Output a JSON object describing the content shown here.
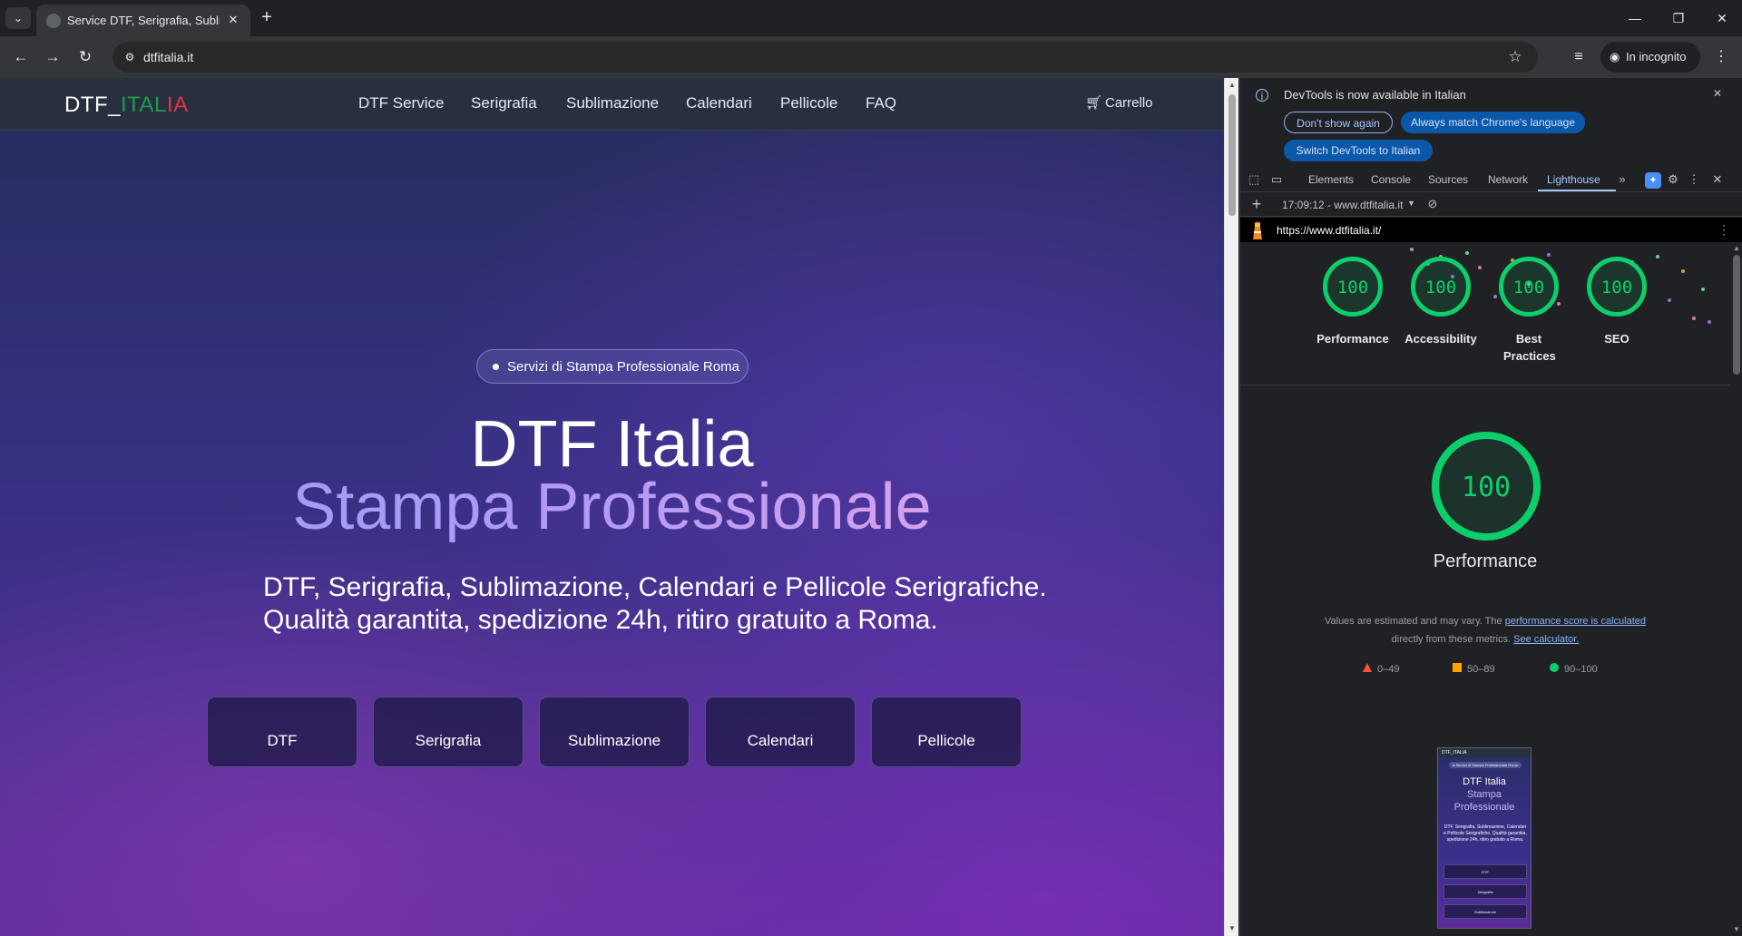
{
  "browser": {
    "tab_title": "Service DTF, Serigrafia, Sublima",
    "url": "dtfitalia.it",
    "incognito_label": "In incognito"
  },
  "site": {
    "logo": {
      "part1": "DTF_",
      "part2": "ITAL",
      "part3": "IA"
    },
    "nav": [
      "DTF Service",
      "Serigrafia",
      "Sublimazione",
      "Calendari",
      "Pellicole",
      "FAQ"
    ],
    "cart_label": "Carrello",
    "badge": "Servizi di Stampa Professionale Roma",
    "headline_line1": "DTF Italia",
    "headline_line2": "Stampa Professionale",
    "subtitle_line1": "DTF, Serigrafia, Sublimazione, Calendari e Pellicole Serigrafiche.",
    "subtitle_line2": "Qualità garantita, spedizione 24h, ritiro gratuito a Roma.",
    "services": [
      "DTF",
      "Serigrafia",
      "Sublimazione",
      "Calendari",
      "Pellicole"
    ]
  },
  "devtools": {
    "infobar": {
      "message": "DevTools is now available in Italian",
      "btn_dont_show": "Don't show again",
      "btn_match_language": "Always match Chrome's language",
      "btn_switch": "Switch DevTools to Italian"
    },
    "tabs": [
      "Elements",
      "Console",
      "Sources",
      "Network",
      "Lighthouse"
    ],
    "active_tab": "Lighthouse",
    "report_selector": "17:09:12 - www.dtfitalia.it",
    "report_url": "https://www.dtfitalia.it/",
    "scores": [
      {
        "label": "Performance",
        "value": "100"
      },
      {
        "label": "Accessibility",
        "value": "100"
      },
      {
        "label": "Best Practices",
        "value": "100"
      },
      {
        "label": "SEO",
        "value": "100"
      }
    ],
    "performance": {
      "score": "100",
      "title": "Performance",
      "note_prefix": "Values are estimated and may vary. The",
      "note_link1": "performance score is calculated",
      "note_middle": "directly from these metrics.",
      "note_link2": "See calculator."
    },
    "legend": [
      "0–49",
      "50–89",
      "90–100"
    ],
    "thumbnail": {
      "logo": "DTF_ITALIA",
      "badge": "● Servizi di Stampa Professionale Roma",
      "line1": "DTF Italia",
      "line2": "Stampa",
      "line3": "Professionale",
      "subtitle": "DTF, Serigrafia, Sublimazione, Calendari e Pellicole Serigrafiche. Qualità garantita, spedizione 24h, ritiro gratuito a Roma.",
      "buttons": [
        "DTF",
        "Serigrafia",
        "Sublimazione"
      ]
    }
  },
  "colors": {
    "score_good": "#0cce6b",
    "legend_fail": "#ff4e42",
    "legend_average": "#ffa400",
    "legend_pass": "#0cce6b",
    "logo_green": "#1e9b4b",
    "logo_red": "#e0353e"
  },
  "icons": [
    "search-tabs-icon",
    "favicon-icon",
    "close-icon",
    "new-tab-icon",
    "back-icon",
    "forward-icon",
    "reload-icon",
    "site-info-icon",
    "star-icon",
    "media-controls-icon",
    "incognito-icon",
    "menu-icon",
    "cart-icon",
    "info-icon",
    "inspect-icon",
    "device-toolbar-icon",
    "more-tabs-icon",
    "settings-icon",
    "block-icon",
    "lighthouse-icon"
  ]
}
